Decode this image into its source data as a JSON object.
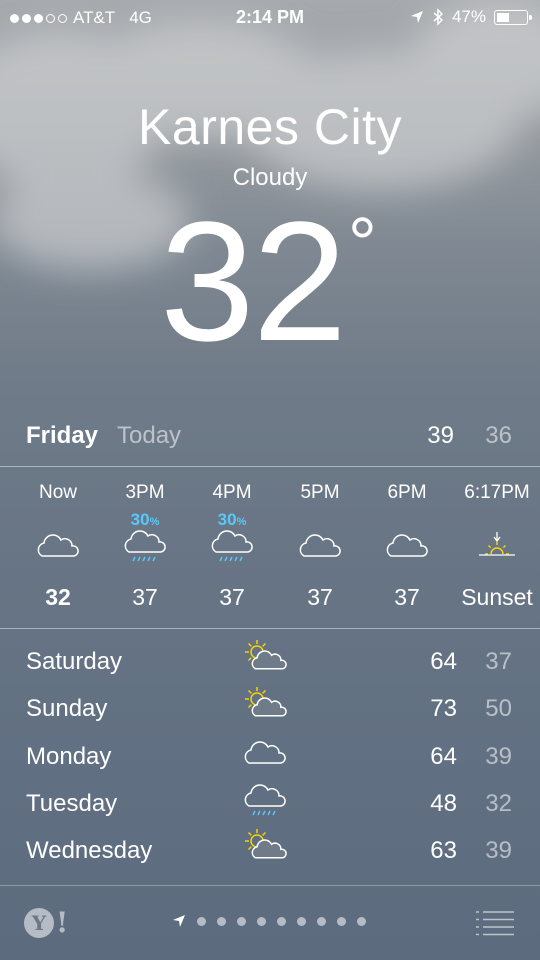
{
  "status_bar": {
    "carrier": "AT&T",
    "network": "4G",
    "time": "2:14 PM",
    "battery": "47%",
    "battery_level": 0.47,
    "signal_bars_filled": 3,
    "signal_bars_total": 5
  },
  "current": {
    "city": "Karnes City",
    "condition": "Cloudy",
    "temperature": "32",
    "degree_symbol": "°"
  },
  "today": {
    "day": "Friday",
    "label": "Today",
    "high": "39",
    "low": "36"
  },
  "hourly": [
    {
      "time": "Now",
      "precip": "",
      "icon": "cloud-icon",
      "temp": "32",
      "bold": true
    },
    {
      "time": "3PM",
      "precip": "30",
      "icon": "cloud-rain-icon",
      "temp": "37"
    },
    {
      "time": "4PM",
      "precip": "30",
      "icon": "cloud-rain-icon",
      "temp": "37"
    },
    {
      "time": "5PM",
      "precip": "",
      "icon": "cloud-icon",
      "temp": "37"
    },
    {
      "time": "6PM",
      "precip": "",
      "icon": "cloud-icon",
      "temp": "37"
    },
    {
      "time": "6:17PM",
      "precip": "",
      "icon": "sunset-icon",
      "temp": "Sunset"
    }
  ],
  "percent_sign": "%",
  "daily": [
    {
      "day": "Saturday",
      "icon": "partly-sunny-icon",
      "high": "64",
      "low": "37"
    },
    {
      "day": "Sunday",
      "icon": "partly-sunny-icon",
      "high": "73",
      "low": "50"
    },
    {
      "day": "Monday",
      "icon": "cloud-icon",
      "high": "64",
      "low": "39"
    },
    {
      "day": "Tuesday",
      "icon": "cloud-rain-icon",
      "high": "48",
      "low": "32"
    },
    {
      "day": "Wednesday",
      "icon": "partly-sunny-icon",
      "high": "63",
      "low": "39"
    }
  ],
  "toolbar": {
    "yahoo_letter": "Y",
    "yahoo_bang": "!",
    "page_count": 10,
    "current_page_icon": "location-arrow-icon"
  },
  "colors": {
    "precip_blue": "#5ac8fa",
    "sun_yellow": "#f5d20a"
  }
}
